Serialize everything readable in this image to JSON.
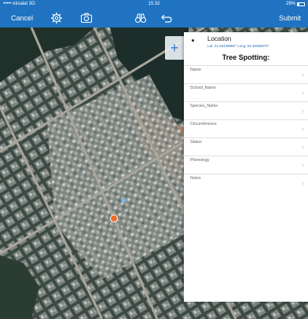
{
  "status_bar": {
    "carrier": "••••• etisalat  3G",
    "time": "15:32",
    "battery": "29%",
    "battery_level": 0.29
  },
  "toolbar": {
    "cancel_label": "Cancel",
    "submit_label": "Submit",
    "icons": [
      "gear-icon",
      "camera-icon",
      "binoculars-icon",
      "undo-icon"
    ]
  },
  "map": {
    "add_label": "+"
  },
  "panel": {
    "location_title": "Location",
    "coords": "Lat: 24.46439986°  Long: 54.38495978°",
    "form_title": "Tree Spotting:",
    "fields": [
      {
        "label": "Name"
      },
      {
        "label": "School_Name"
      },
      {
        "label": "Species_Name"
      },
      {
        "label": "Circumference"
      },
      {
        "label": "Status"
      },
      {
        "label": "Phenology"
      },
      {
        "label": "Notes"
      }
    ]
  },
  "colors": {
    "accent": "#1f73c1",
    "link": "#2b7bd1",
    "marker": "#f06b2a"
  }
}
